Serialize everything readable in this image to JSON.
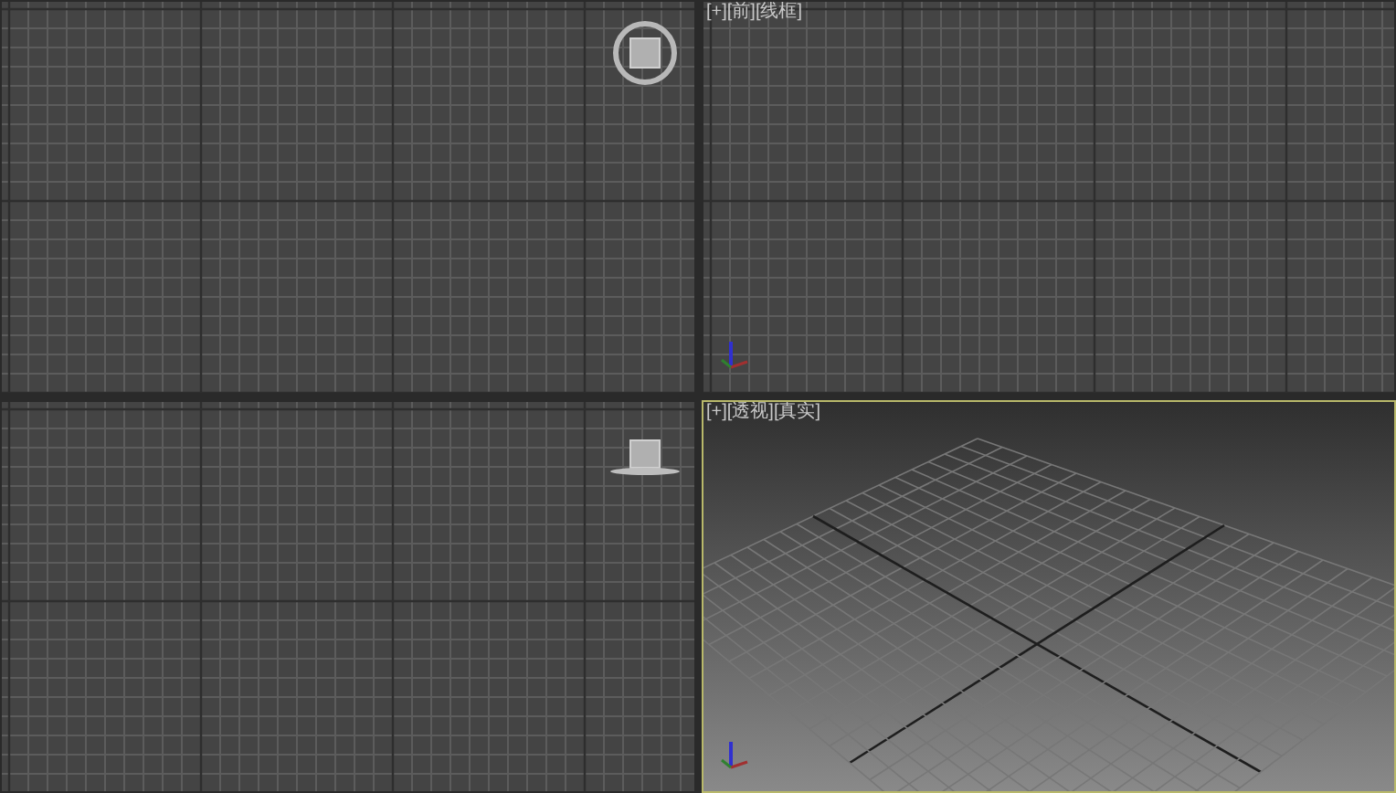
{
  "viewports": [
    {
      "kind": "ortho",
      "gizmo": {
        "kind": "cube"
      },
      "selected": false
    },
    {
      "kind": "ortho",
      "label": "[+][前][线框]",
      "gizmo": {
        "kind": "axis"
      },
      "selected": false
    },
    {
      "kind": "ortho",
      "gizmo": {
        "kind": "flat"
      },
      "selected": false
    },
    {
      "kind": "perspective",
      "label": "[+][透视][真实]",
      "gizmo": {
        "kind": "axis"
      },
      "selected": true
    }
  ]
}
